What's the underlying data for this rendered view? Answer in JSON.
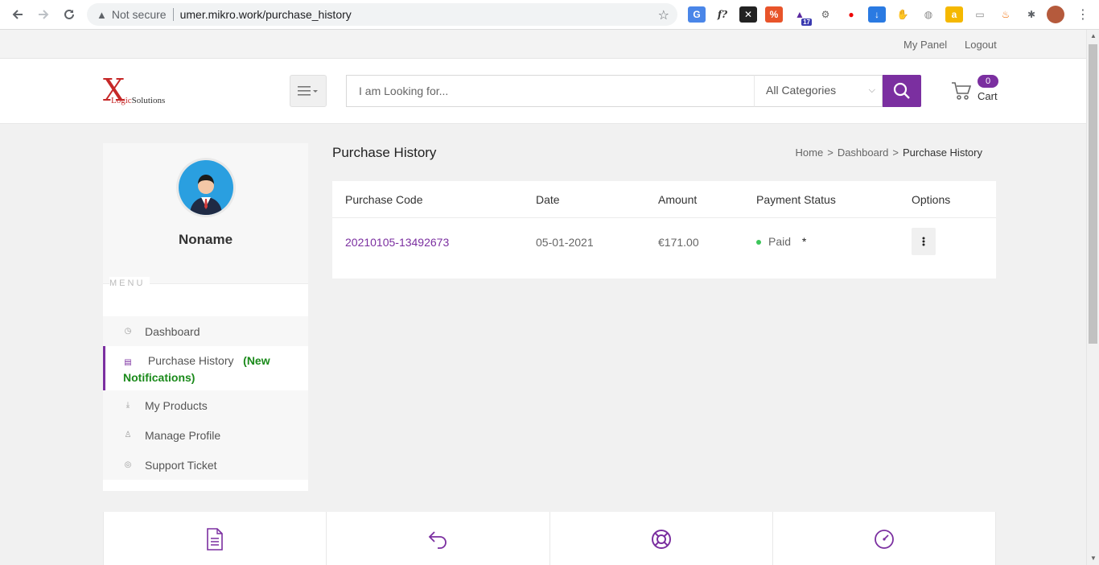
{
  "browser": {
    "security_label": "Not secure",
    "url": "umer.mikro.work/purchase_history",
    "extension_badge": "17"
  },
  "topbar": {
    "my_panel": "My Panel",
    "logout": "Logout"
  },
  "header": {
    "logo_mark": "X",
    "logo_text_a": "Logic",
    "logo_text_b": "Solutions",
    "search_placeholder": "I am Looking for...",
    "category_selected": "All Categories",
    "cart_count": "0",
    "cart_label": "Cart"
  },
  "sidebar": {
    "username": "Noname",
    "menu_label": "MENU",
    "items": [
      {
        "label": "Dashboard",
        "icon": "dashboard-icon"
      },
      {
        "label": "Purchase History",
        "note": "(New Notifications)",
        "icon": "document-icon",
        "active": true
      },
      {
        "label": "My Products",
        "icon": "download-icon"
      },
      {
        "label": "Manage Profile",
        "icon": "user-icon"
      },
      {
        "label": "Support Ticket",
        "icon": "support-icon"
      }
    ]
  },
  "main": {
    "title": "Purchase History",
    "breadcrumb": [
      "Home",
      "Dashboard",
      "Purchase History"
    ],
    "table": {
      "headers": [
        "Purchase Code",
        "Date",
        "Amount",
        "Payment Status",
        "Options"
      ],
      "rows": [
        {
          "code": "20210105-13492673",
          "date": "05-01-2021",
          "amount": "€171.00",
          "status": "Paid",
          "status_mark": "*"
        }
      ]
    }
  },
  "colors": {
    "accent": "#7b2fa0",
    "paid": "#3cc55a",
    "notification": "#1a8a1a"
  }
}
